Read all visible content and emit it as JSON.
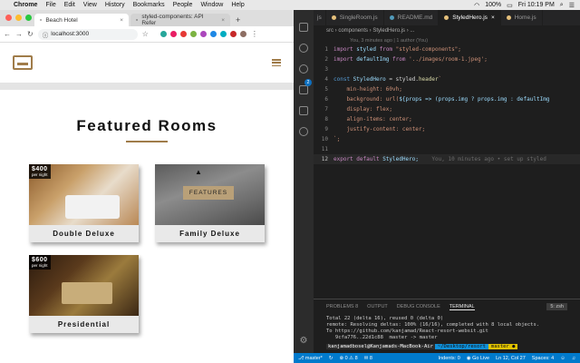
{
  "menubar": {
    "app": "Chrome",
    "items": [
      "File",
      "Edit",
      "View",
      "History",
      "Bookmarks",
      "People",
      "Window",
      "Help"
    ],
    "battery": "100%",
    "clock": "Fri 10:19 PM"
  },
  "browser": {
    "tabs": [
      {
        "label": "Beach Hotel",
        "active": true
      },
      {
        "label": "styled-components: API Refer",
        "active": false
      }
    ],
    "url": "localhost:3000"
  },
  "site": {
    "section_title": "Featured Rooms",
    "features_button": "FEATURES",
    "rooms": [
      {
        "name": "Double Deluxe",
        "price": "$400",
        "per": "per night"
      },
      {
        "name": "Family Deluxe",
        "price": "",
        "per": ""
      },
      {
        "name": "Presidential",
        "price": "$600",
        "per": "per night"
      }
    ]
  },
  "vscode": {
    "tabs": [
      {
        "label": "SingleRoom.js"
      },
      {
        "label": "README.md"
      },
      {
        "label": "StyledHero.js"
      },
      {
        "label": "Home.js"
      }
    ],
    "breadcrumb": "src › components › StyledHero.js › ...",
    "blame": "You, 3 minutes ago | 1 author (You)",
    "ghost_blame": "You, 10 minutes ago • set up styled",
    "line_numbers": [
      "1",
      "2",
      "3",
      "4",
      "5",
      "6",
      "7",
      "8",
      "9",
      "10",
      "11",
      "12"
    ],
    "code": {
      "l1a": "import",
      "l1b": " styled ",
      "l1c": "from",
      "l1d": " \"styled-components\";",
      "l2a": "import",
      "l2b": " defaultImg ",
      "l2c": "from",
      "l2d": " '../images/room-1.jpeg';",
      "l4a": "const",
      "l4b": " StyledHero ",
      "l4c": "= styled.",
      "l4d": "header",
      "l4e": "`",
      "l5": "    min-height: 60vh;",
      "l6a": "    background: url(",
      "l6b": "${props => (props.img ? props.img : defaultImg",
      "l7": "    display: flex;",
      "l8": "    align-items: center;",
      "l9": "    justify-content: center;",
      "l10": "`;",
      "l12a": "export default",
      "l12b": " StyledHero;"
    },
    "panel_tabs": {
      "problems": "PROBLEMS",
      "problems_count": "8",
      "output": "OUTPUT",
      "debug": "DEBUG CONSOLE",
      "terminal": "TERMINAL",
      "shell": "5: zsh"
    },
    "terminal_lines": [
      "Total 22 (delta 16), reused 0 (delta 0)",
      "remote: Resolving deltas: 100% (16/16), completed with 8 local objects.",
      "To https://github.com/kanjamad/React-resort-websit.git",
      "   9cfa776..22d1c88  master -> master"
    ],
    "prompt": {
      "user": "kanjamadbosel@Kanjamads-MacBook-Air",
      "path": "~/Desktop/resort",
      "branch": "master ●"
    },
    "status": {
      "branch": "master*",
      "errors": "0",
      "warnings": "8",
      "notify": "8",
      "golive": "Go Live",
      "position": "Ln 12, Col 27",
      "spaces": "Spaces: 4",
      "indents": "Indents: 0"
    }
  }
}
